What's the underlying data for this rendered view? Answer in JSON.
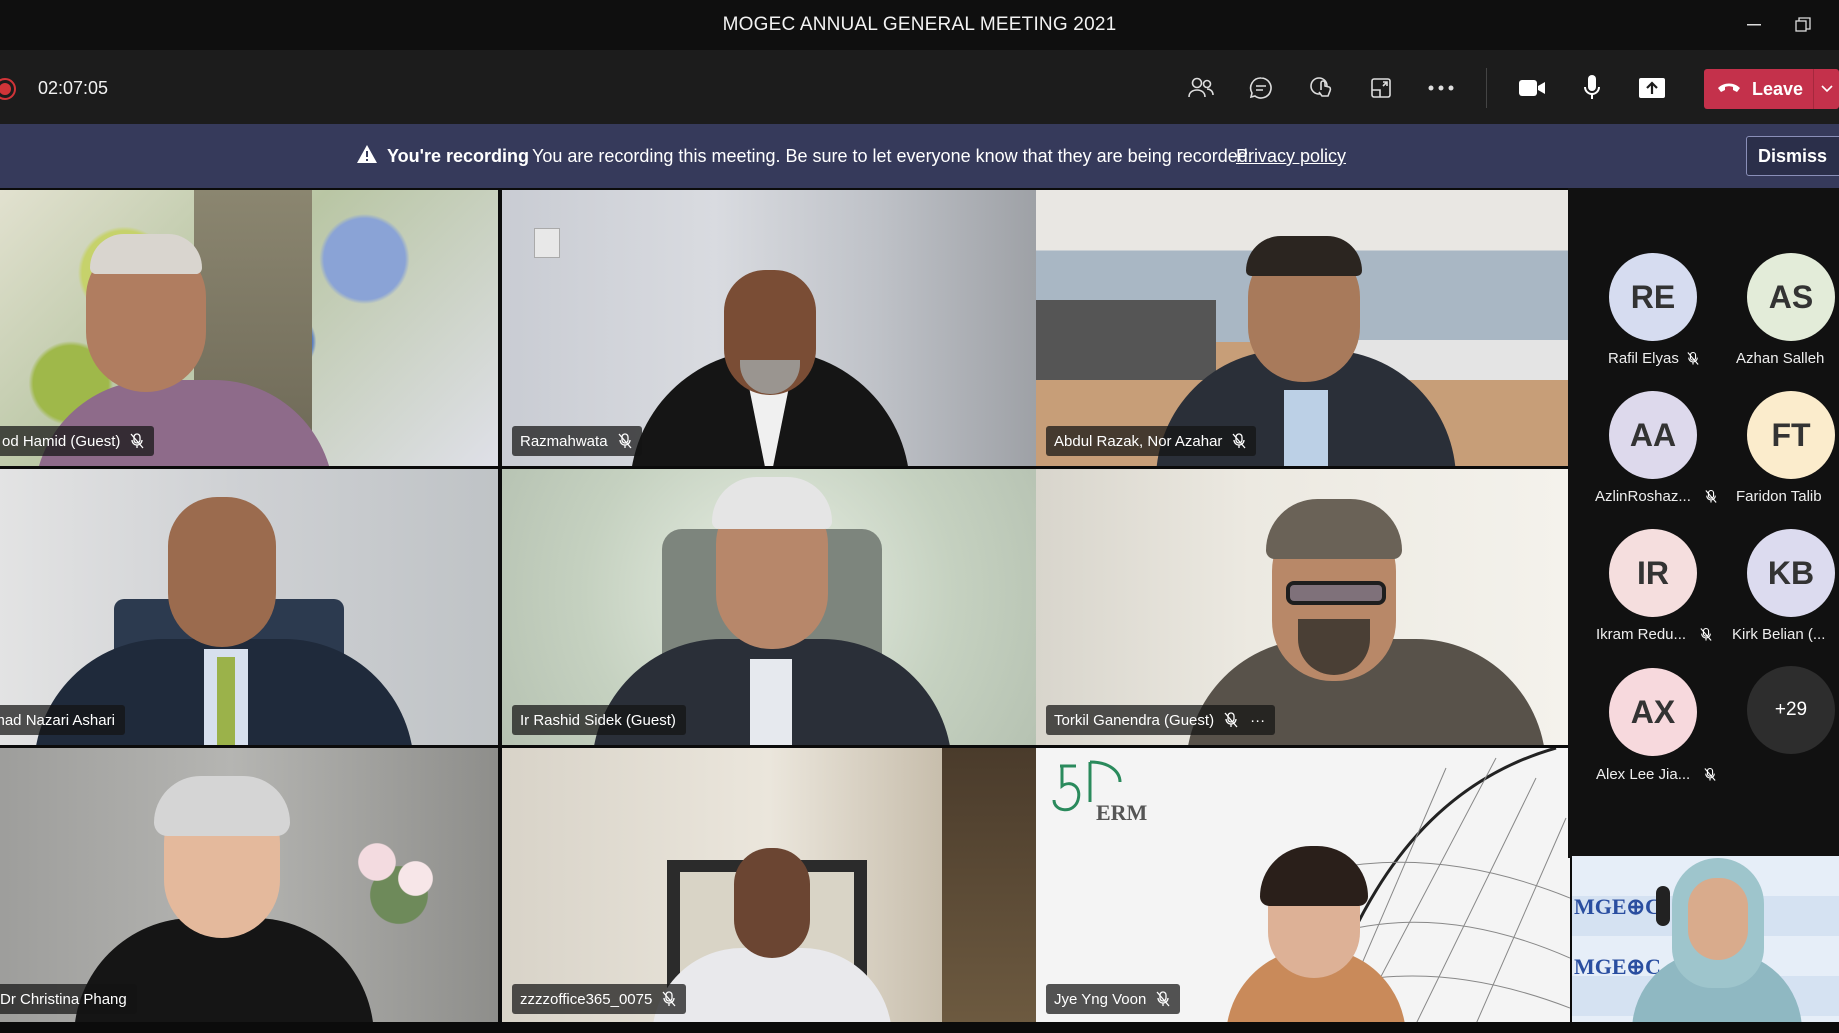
{
  "window": {
    "title": "MOGEC ANNUAL GENERAL MEETING 2021"
  },
  "toolbar": {
    "timer": "02:07:05",
    "leave_label": "Leave",
    "icons": [
      "participants-icon",
      "chat-icon",
      "reactions-icon",
      "rooms-icon",
      "more-icon",
      "camera-icon",
      "mic-icon",
      "share-icon"
    ]
  },
  "banner": {
    "strong": "You're recording",
    "message": "You are recording this meeting. Be sure to let everyone know that they are being recorded.",
    "link": "Privacy policy",
    "dismiss": "Dismiss"
  },
  "tiles": [
    {
      "name": "od Hamid (Guest)"
    },
    {
      "name": "Razmahwata"
    },
    {
      "name": "Abdul Razak, Nor Azahar"
    },
    {
      "name": "Ahmad Nazari Ashari"
    },
    {
      "name": "Ir Rashid Sidek (Guest)"
    },
    {
      "name": "Torkil Ganendra (Guest)",
      "more": "···"
    },
    {
      "name": "Dr Christina Phang"
    },
    {
      "name": "zzzzoffice365_0075"
    },
    {
      "name": "Jye Yng Voon",
      "logo_text": "ERM"
    }
  ],
  "roster": [
    {
      "initials": "RE",
      "name": "Rafil Elyas",
      "color": "#d6dcf0"
    },
    {
      "initials": "AS",
      "name": "Azhan Salleh",
      "color": "#e3ecd9"
    },
    {
      "initials": "AA",
      "name": "AzlinRoshaz...",
      "color": "#ddd9ec"
    },
    {
      "initials": "FT",
      "name": "Faridon Talib",
      "color": "#fbeccc"
    },
    {
      "initials": "IR",
      "name": "Ikram Redu...",
      "color": "#f5dede"
    },
    {
      "initials": "KB",
      "name": "Kirk Belian (...",
      "color": "#dcdbef"
    },
    {
      "initials": "AX",
      "name": "Alex Lee Jia...",
      "color": "#f7d9dd"
    }
  ],
  "overflow_count": "+29",
  "self_view": {
    "backdrop_text": "MGE⊕C"
  }
}
